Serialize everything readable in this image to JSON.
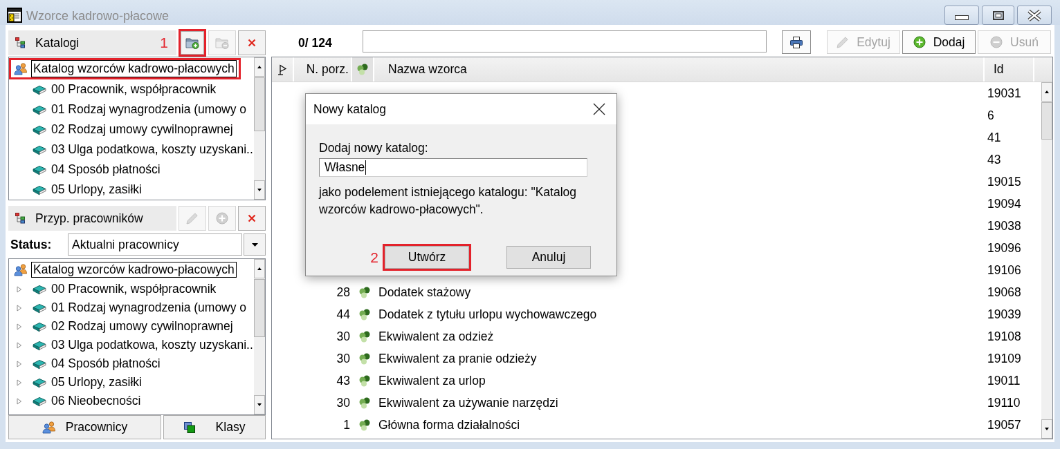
{
  "window": {
    "title": "Wzorce kadrowo-płacowe"
  },
  "katalogi_panel": {
    "title": "Katalogi",
    "buttons": [
      {
        "kind": "add-folder",
        "disabled": false,
        "highlighted": true,
        "callout": "1"
      },
      {
        "kind": "remove-folder",
        "disabled": true,
        "highlighted": false
      },
      {
        "kind": "delete",
        "disabled": false,
        "highlighted": false
      }
    ],
    "tree": [
      {
        "label": "Katalog wzorców kadrowo-płacowych",
        "kind": "people",
        "selected": true,
        "highlighted": true,
        "children": [
          {
            "label": "00 Pracownik, współpracownik",
            "kind": "book",
            "selected": false,
            "highlighted": false
          },
          {
            "label": "01 Rodzaj wynagrodzenia (umowy o",
            "kind": "book",
            "selected": false,
            "highlighted": false
          },
          {
            "label": "02 Rodzaj umowy cywilnoprawnej",
            "kind": "book",
            "selected": false,
            "highlighted": false
          },
          {
            "label": "03 Ulga podatkowa, koszty uzyskani..",
            "kind": "book",
            "selected": false,
            "highlighted": false
          },
          {
            "label": "04 Sposób płatności",
            "kind": "book",
            "selected": false,
            "highlighted": false
          },
          {
            "label": "05 Urlopy, zasiłki",
            "kind": "book",
            "selected": false,
            "highlighted": false
          }
        ]
      }
    ]
  },
  "przyp_panel": {
    "title": "Przyp. pracowników",
    "buttons": [
      {
        "kind": "edit",
        "disabled": true,
        "highlighted": false
      },
      {
        "kind": "add",
        "disabled": true,
        "highlighted": false
      },
      {
        "kind": "delete",
        "disabled": false,
        "highlighted": false
      }
    ],
    "status": {
      "label": "Status:",
      "value": "Aktualni pracownicy"
    },
    "tree": [
      {
        "label": "Katalog wzorców kadrowo-płacowych",
        "kind": "people",
        "selected": true,
        "highlighted": false,
        "children": [
          {
            "label": "00 Pracownik, współpracownik",
            "kind": "book",
            "selected": false,
            "highlighted": false,
            "expanded": false
          },
          {
            "label": "01 Rodzaj wynagrodzenia (umowy o",
            "kind": "book",
            "selected": false,
            "highlighted": false,
            "expanded": false
          },
          {
            "label": "02 Rodzaj umowy cywilnoprawnej",
            "kind": "book",
            "selected": false,
            "highlighted": false,
            "expanded": false
          },
          {
            "label": "03 Ulga podatkowa, koszty uzyskani..",
            "kind": "book",
            "selected": false,
            "highlighted": false,
            "expanded": false
          },
          {
            "label": "04 Sposób płatności",
            "kind": "book",
            "selected": false,
            "highlighted": false,
            "expanded": false
          },
          {
            "label": "05 Urlopy, zasiłki",
            "kind": "book",
            "selected": false,
            "highlighted": false,
            "expanded": false
          },
          {
            "label": "06 Nieobecności",
            "kind": "book",
            "selected": false,
            "highlighted": false,
            "expanded": false
          }
        ]
      }
    ]
  },
  "bottom_buttons": [
    {
      "label": "Pracownicy",
      "kind": "people"
    },
    {
      "label": "Klasy",
      "kind": "classes"
    }
  ],
  "toolbar": {
    "counter": "0/ 124",
    "buttons": [
      {
        "kind": "print",
        "disabled": false
      },
      {
        "kind": "edit",
        "label": "Edytuj",
        "disabled": true
      },
      {
        "kind": "add",
        "label": "Dodaj",
        "disabled": false
      },
      {
        "kind": "remove",
        "label": "Usuń",
        "disabled": true
      }
    ]
  },
  "table": {
    "columns": [
      {
        "kind": "flag"
      },
      {
        "kind": "number",
        "label": "N. porz."
      },
      {
        "kind": "icon"
      },
      {
        "kind": "name",
        "label": "Nazwa wzorca"
      },
      {
        "kind": "id",
        "label": "Id"
      }
    ],
    "rows": [
      {
        "id": "19031"
      },
      {
        "id": "6"
      },
      {
        "id": "41"
      },
      {
        "id": "43"
      },
      {
        "id": "19015"
      },
      {
        "id": "19094"
      },
      {
        "id": "19038"
      },
      {
        "id": "19096"
      },
      {
        "id": "19106"
      },
      {
        "number": "28",
        "name": "Dodatek stażowy",
        "id": "19068"
      },
      {
        "number": "44",
        "name": "Dodatek z tytułu urlopu wychowawczego",
        "id": "19039"
      },
      {
        "number": "30",
        "name": "Ekwiwalent za odzież",
        "id": "19108"
      },
      {
        "number": "30",
        "name": "Ekwiwalent za pranie odzieży",
        "id": "19109"
      },
      {
        "number": "43",
        "name": "Ekwiwalent za urlop",
        "id": "19011"
      },
      {
        "number": "30",
        "name": "Ekwiwalent za używanie narzędzi",
        "id": "19110"
      },
      {
        "number": "1",
        "name": "Główna forma działalności",
        "id": "19057"
      }
    ]
  },
  "dialog": {
    "title": "Nowy katalog",
    "field_label": "Dodaj nowy katalog:",
    "value": "Własne",
    "note": "jako podelement istniejącego katalogu: \"Katalog wzorców kadrowo-płacowych\".",
    "buttons": [
      {
        "label": "Utwórz",
        "highlighted": true,
        "callout": "2"
      },
      {
        "label": "Anuluj",
        "highlighted": false
      }
    ]
  }
}
